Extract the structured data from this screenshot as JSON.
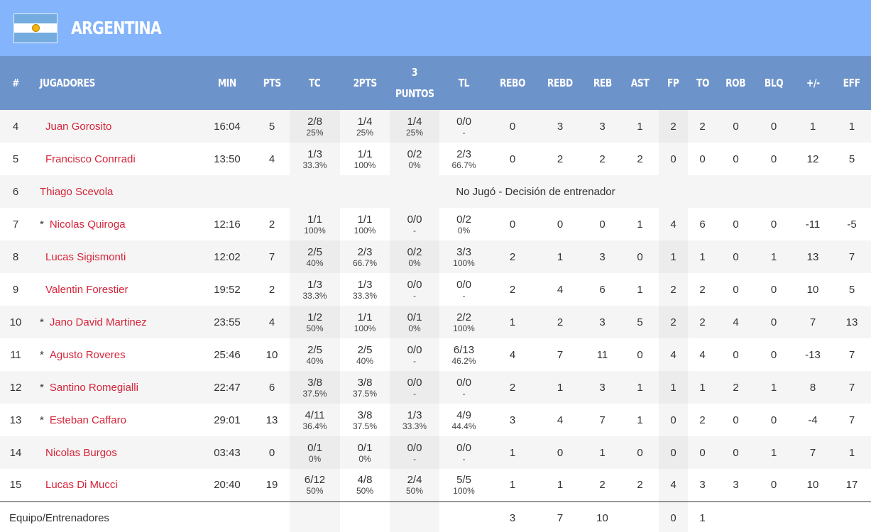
{
  "team": {
    "name": "ARGENTINA"
  },
  "header": {
    "num": "#",
    "player": "JUGADORES",
    "min": "MIN",
    "pts": "PTS",
    "tc": "TC",
    "two": "2PTS",
    "three_a": "3",
    "three_b": "PUNTOS",
    "tl": "TL",
    "rebo": "REBO",
    "rebd": "REBD",
    "reb": "REB",
    "ast": "AST",
    "fp": "FP",
    "to": "TO",
    "rob": "ROB",
    "blq": "BLQ",
    "pm": "+/-",
    "eff": "EFF"
  },
  "players": [
    {
      "num": "4",
      "star": "",
      "name": "Juan Gorosito",
      "min": "16:04",
      "pts": "5",
      "tc": "2/8",
      "tc_pct": "25%",
      "two": "1/4",
      "two_pct": "25%",
      "three": "1/4",
      "three_pct": "25%",
      "tl": "0/0",
      "tl_pct": "-",
      "rebo": "0",
      "rebd": "3",
      "reb": "3",
      "ast": "1",
      "fp": "2",
      "to": "2",
      "rob": "0",
      "blq": "0",
      "pm": "1",
      "eff": "1"
    },
    {
      "num": "5",
      "star": "",
      "name": "Francisco Conrradi",
      "min": "13:50",
      "pts": "4",
      "tc": "1/3",
      "tc_pct": "33.3%",
      "two": "1/1",
      "two_pct": "100%",
      "three": "0/2",
      "three_pct": "0%",
      "tl": "2/3",
      "tl_pct": "66.7%",
      "rebo": "0",
      "rebd": "2",
      "reb": "2",
      "ast": "2",
      "fp": "0",
      "to": "0",
      "rob": "0",
      "blq": "0",
      "pm": "12",
      "eff": "5"
    },
    {
      "num": "7",
      "star": "*",
      "name": "Nicolas Quiroga",
      "min": "12:16",
      "pts": "2",
      "tc": "1/1",
      "tc_pct": "100%",
      "two": "1/1",
      "two_pct": "100%",
      "three": "0/0",
      "three_pct": "-",
      "tl": "0/2",
      "tl_pct": "0%",
      "rebo": "0",
      "rebd": "0",
      "reb": "0",
      "ast": "1",
      "fp": "4",
      "to": "6",
      "rob": "0",
      "blq": "0",
      "pm": "-11",
      "eff": "-5"
    },
    {
      "num": "8",
      "star": "",
      "name": "Lucas Sigismonti",
      "min": "12:02",
      "pts": "7",
      "tc": "2/5",
      "tc_pct": "40%",
      "two": "2/3",
      "two_pct": "66.7%",
      "three": "0/2",
      "three_pct": "0%",
      "tl": "3/3",
      "tl_pct": "100%",
      "rebo": "2",
      "rebd": "1",
      "reb": "3",
      "ast": "0",
      "fp": "1",
      "to": "1",
      "rob": "0",
      "blq": "1",
      "pm": "13",
      "eff": "7"
    },
    {
      "num": "9",
      "star": "",
      "name": "Valentin Forestier",
      "min": "19:52",
      "pts": "2",
      "tc": "1/3",
      "tc_pct": "33.3%",
      "two": "1/3",
      "two_pct": "33.3%",
      "three": "0/0",
      "three_pct": "-",
      "tl": "0/0",
      "tl_pct": "-",
      "rebo": "2",
      "rebd": "4",
      "reb": "6",
      "ast": "1",
      "fp": "2",
      "to": "2",
      "rob": "0",
      "blq": "0",
      "pm": "10",
      "eff": "5"
    },
    {
      "num": "10",
      "star": "*",
      "name": "Jano David Martinez",
      "min": "23:55",
      "pts": "4",
      "tc": "1/2",
      "tc_pct": "50%",
      "two": "1/1",
      "two_pct": "100%",
      "three": "0/1",
      "three_pct": "0%",
      "tl": "2/2",
      "tl_pct": "100%",
      "rebo": "1",
      "rebd": "2",
      "reb": "3",
      "ast": "5",
      "fp": "2",
      "to": "2",
      "rob": "4",
      "blq": "0",
      "pm": "7",
      "eff": "13"
    },
    {
      "num": "11",
      "star": "*",
      "name": "Agusto Roveres",
      "min": "25:46",
      "pts": "10",
      "tc": "2/5",
      "tc_pct": "40%",
      "two": "2/5",
      "two_pct": "40%",
      "three": "0/0",
      "three_pct": "-",
      "tl": "6/13",
      "tl_pct": "46.2%",
      "rebo": "4",
      "rebd": "7",
      "reb": "11",
      "ast": "0",
      "fp": "4",
      "to": "4",
      "rob": "0",
      "blq": "0",
      "pm": "-13",
      "eff": "7"
    },
    {
      "num": "12",
      "star": "*",
      "name": "Santino Romegialli",
      "min": "22:47",
      "pts": "6",
      "tc": "3/8",
      "tc_pct": "37.5%",
      "two": "3/8",
      "two_pct": "37.5%",
      "three": "0/0",
      "three_pct": "-",
      "tl": "0/0",
      "tl_pct": "-",
      "rebo": "2",
      "rebd": "1",
      "reb": "3",
      "ast": "1",
      "fp": "1",
      "to": "1",
      "rob": "2",
      "blq": "1",
      "pm": "8",
      "eff": "7"
    },
    {
      "num": "13",
      "star": "*",
      "name": "Esteban Caffaro",
      "min": "29:01",
      "pts": "13",
      "tc": "4/11",
      "tc_pct": "36.4%",
      "two": "3/8",
      "two_pct": "37.5%",
      "three": "1/3",
      "three_pct": "33.3%",
      "tl": "4/9",
      "tl_pct": "44.4%",
      "rebo": "3",
      "rebd": "4",
      "reb": "7",
      "ast": "1",
      "fp": "0",
      "to": "2",
      "rob": "0",
      "blq": "0",
      "pm": "-4",
      "eff": "7"
    },
    {
      "num": "14",
      "star": "",
      "name": "Nicolas Burgos",
      "min": "03:43",
      "pts": "0",
      "tc": "0/1",
      "tc_pct": "0%",
      "two": "0/1",
      "two_pct": "0%",
      "three": "0/0",
      "three_pct": "-",
      "tl": "0/0",
      "tl_pct": "-",
      "rebo": "1",
      "rebd": "0",
      "reb": "1",
      "ast": "0",
      "fp": "0",
      "to": "0",
      "rob": "0",
      "blq": "1",
      "pm": "7",
      "eff": "1"
    },
    {
      "num": "15",
      "star": "",
      "name": "Lucas Di Mucci",
      "min": "20:40",
      "pts": "19",
      "tc": "6/12",
      "tc_pct": "50%",
      "two": "4/8",
      "two_pct": "50%",
      "three": "2/4",
      "three_pct": "50%",
      "tl": "5/5",
      "tl_pct": "100%",
      "rebo": "1",
      "rebd": "1",
      "reb": "2",
      "ast": "2",
      "fp": "4",
      "to": "3",
      "rob": "3",
      "blq": "0",
      "pm": "10",
      "eff": "17"
    }
  ],
  "dnp": {
    "num": "6",
    "name": "Thiago Scevola",
    "note": "No Jugó - Decisión de entrenador"
  },
  "team_row": {
    "label": "Equipo/Entrenadores",
    "rebo": "3",
    "rebd": "7",
    "reb": "10",
    "fp": "0",
    "to": "1"
  }
}
